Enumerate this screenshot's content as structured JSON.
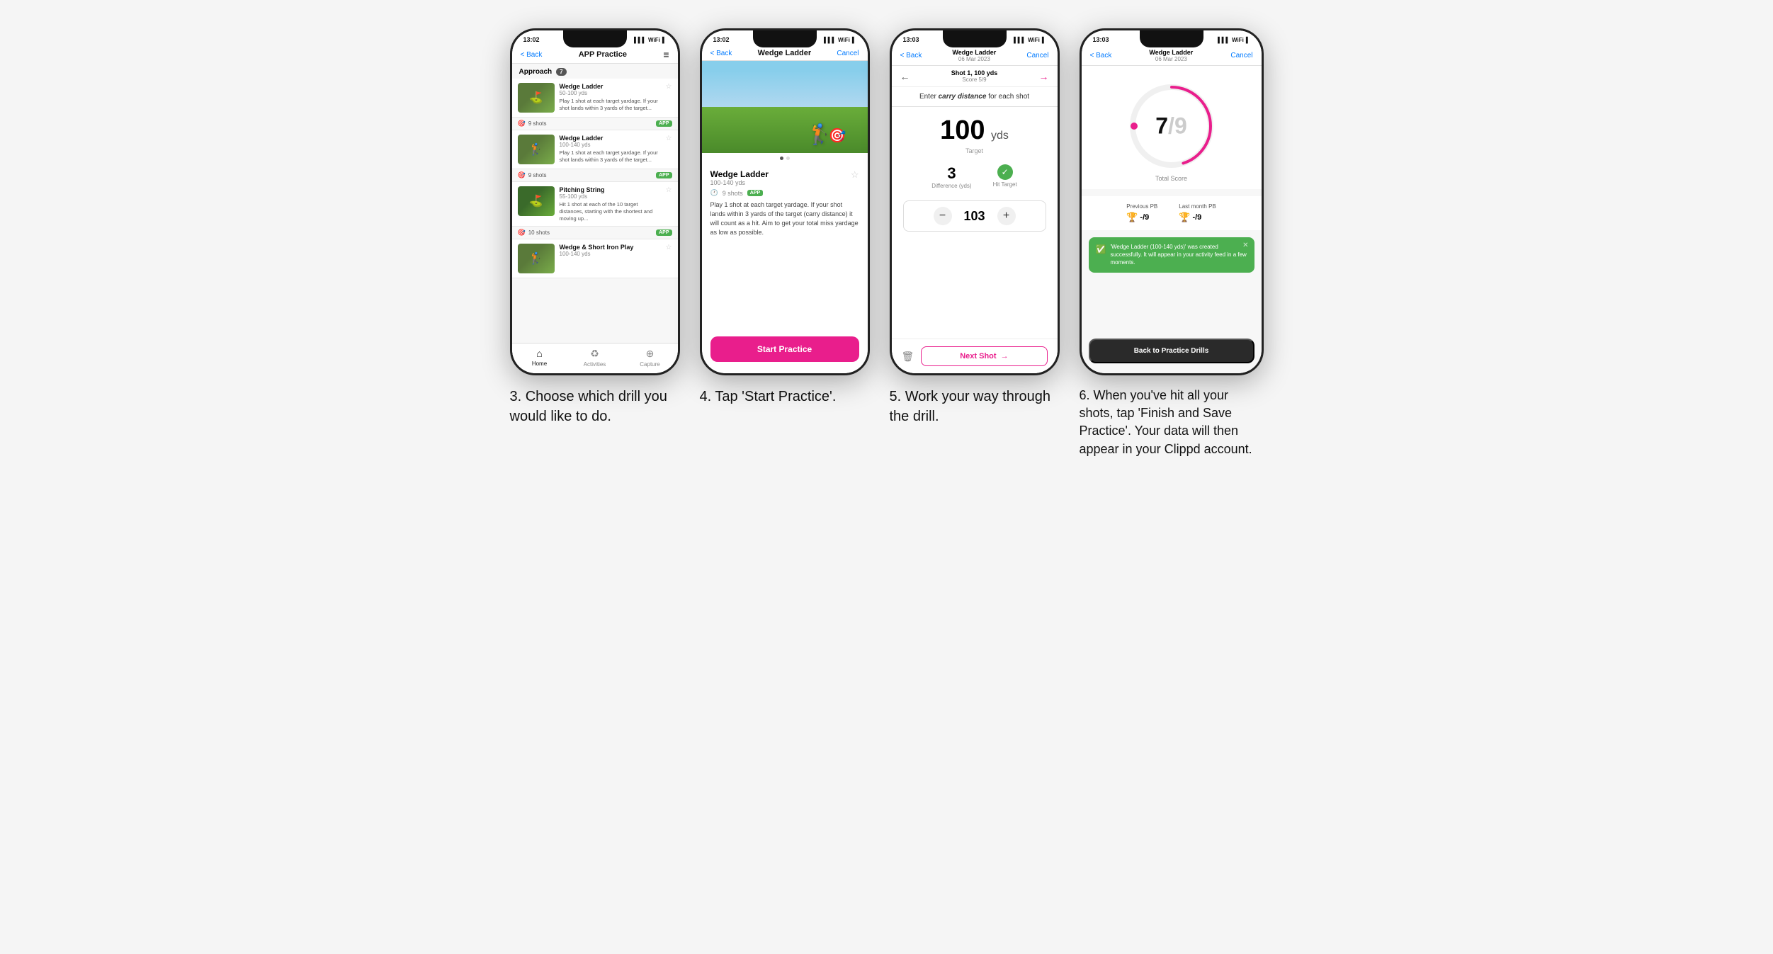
{
  "phones": [
    {
      "id": "phone1",
      "time": "13:02",
      "nav": {
        "back": "< Back",
        "title": "APP Practice",
        "menu": "≡"
      },
      "section": "Approach",
      "section_count": "7",
      "drills": [
        {
          "name": "Wedge Ladder",
          "yds": "50-100 yds",
          "desc": "Play 1 shot at each target yardage. If your shot lands within 3 yards of the target...",
          "shots": "9 shots",
          "badge": "APP"
        },
        {
          "name": "Wedge Ladder",
          "yds": "100-140 yds",
          "desc": "Play 1 shot at each target yardage. If your shot lands within 3 yards of the target...",
          "shots": "9 shots",
          "badge": "APP"
        },
        {
          "name": "Pitching String",
          "yds": "55-100 yds",
          "desc": "Hit 1 shot at each of the 10 target distances, starting with the shortest and moving up...",
          "shots": "10 shots",
          "badge": "APP"
        },
        {
          "name": "Wedge & Short Iron Play",
          "yds": "100-140 yds",
          "desc": "",
          "shots": "",
          "badge": ""
        }
      ],
      "bottom_nav": [
        "Home",
        "Activities",
        "Capture"
      ]
    },
    {
      "id": "phone2",
      "time": "13:02",
      "nav": {
        "back": "< Back",
        "title": "Wedge Ladder",
        "cancel": "Cancel"
      },
      "drill_name": "Wedge Ladder",
      "drill_yds": "100-140 yds",
      "drill_shots": "9 shots",
      "drill_badge": "APP",
      "drill_desc": "Play 1 shot at each target yardage. If your shot lands within 3 yards of the target (carry distance) it will count as a hit. Aim to get your total miss yardage as low as possible.",
      "start_btn": "Start Practice"
    },
    {
      "id": "phone3",
      "time": "13:03",
      "nav": {
        "back": "< Back",
        "title": "Wedge Ladder",
        "subtitle": "06 Mar 2023",
        "cancel": "Cancel"
      },
      "shot_label": "Shot 1, 100 yds",
      "score_label": "Score 5/9",
      "carry_instruction": "Enter carry distance for each shot",
      "target_yds": "100",
      "target_unit": "yds",
      "target_label": "Target",
      "difference": "3",
      "difference_label": "Difference (yds)",
      "hit_target": "Hit Target",
      "input_value": "103",
      "next_shot": "Next Shot"
    },
    {
      "id": "phone4",
      "time": "13:03",
      "nav": {
        "back": "< Back",
        "title": "Wedge Ladder",
        "subtitle": "06 Mar 2023",
        "cancel": "Cancel"
      },
      "score_numerator": "7",
      "score_denominator": "/9",
      "total_score_label": "Total Score",
      "previous_pb_label": "Previous PB",
      "previous_pb": "-/9",
      "last_month_pb_label": "Last month PB",
      "last_month_pb": "-/9",
      "toast_text": "'Wedge Ladder (100-140 yds)' was created successfully. It will appear in your activity feed in a few moments.",
      "back_btn": "Back to Practice Drills"
    }
  ],
  "captions": [
    "3. Choose which drill you would like to do.",
    "4. Tap 'Start Practice'.",
    "5. Work your way through the drill.",
    "6. When you've hit all your shots, tap 'Finish and Save Practice'. Your data will then appear in your Clippd account."
  ]
}
